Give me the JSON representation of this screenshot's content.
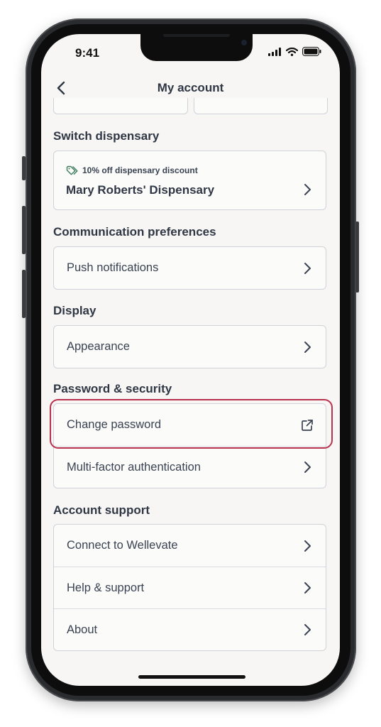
{
  "status_bar": {
    "time": "9:41"
  },
  "nav": {
    "title": "My account"
  },
  "sections": {
    "switch_dispensary": {
      "heading": "Switch dispensary",
      "discount_label": "10% off dispensary discount",
      "dispensary_name": "Mary Roberts' Dispensary"
    },
    "communication": {
      "heading": "Communication preferences",
      "items": [
        "Push notifications"
      ]
    },
    "display": {
      "heading": "Display",
      "items": [
        "Appearance"
      ]
    },
    "security": {
      "heading": "Password & security",
      "items": [
        "Change password",
        "Multi-factor authentication"
      ]
    },
    "support": {
      "heading": "Account support",
      "items": [
        "Connect to Wellevate",
        "Help & support",
        "About"
      ]
    }
  },
  "colors": {
    "highlight_border": "#b8314d",
    "tag_icon": "#3f7d5c",
    "screen_bg": "#f7f6f4"
  }
}
